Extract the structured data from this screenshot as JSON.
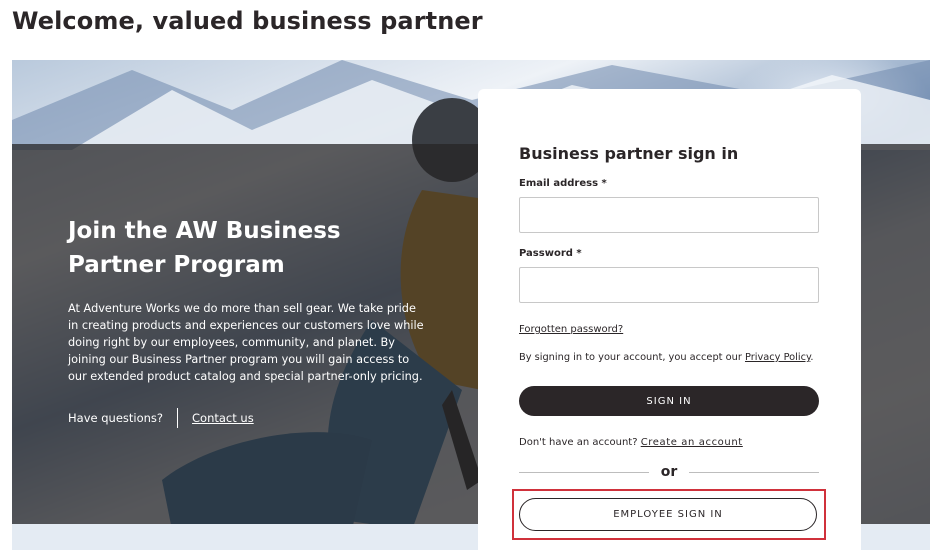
{
  "page": {
    "title": "Welcome, valued business partner"
  },
  "hero": {
    "heading": "Join the AW Business Partner Program",
    "body": "At Adventure Works we do more than sell gear. We take pride in creating products and experiences our customers love while doing right by our employees, community, and planet. By joining our Business Partner program you will gain access to our extended product catalog and special partner-only pricing.",
    "questions_label": "Have questions?",
    "contact_link": "Contact us"
  },
  "signin": {
    "title": "Business partner sign in",
    "email_label": "Email address *",
    "email_value": "",
    "password_label": "Password *",
    "password_value": "",
    "forgot_link": "Forgotten password?",
    "consent_text": "By signing in to your account, you accept our ",
    "privacy_link": "Privacy Policy",
    "consent_end": ".",
    "signin_button": "SIGN IN",
    "no_account_text": "Don't have an account? ",
    "create_account_link": "Create an account",
    "or_text": "or",
    "employee_button": "EMPLOYEE SIGN IN"
  },
  "colors": {
    "primary": "#2b2628",
    "highlight": "#d0313b",
    "overlay": "#262426"
  }
}
